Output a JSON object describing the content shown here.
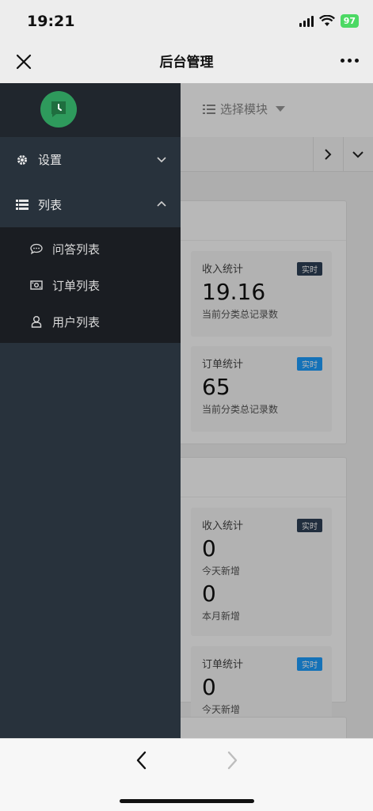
{
  "status": {
    "time": "19:21",
    "battery": "97"
  },
  "nav": {
    "title": "后台管理"
  },
  "topbar": {
    "module_select": "选择模块"
  },
  "panels": [
    {
      "cards": [
        {
          "label": "收入统计",
          "badge": "实时",
          "value": "19.16",
          "sub": "当前分类总记录数"
        },
        {
          "label": "订单统计",
          "badge": "实时",
          "value": "65",
          "sub": "当前分类总记录数"
        }
      ]
    },
    {
      "cards": [
        {
          "label": "收入统计",
          "badge": "实时",
          "value": "0",
          "sub": "今天新增",
          "value2": "0",
          "sub2": "本月新增"
        },
        {
          "label": "订单统计",
          "badge": "实时",
          "value": "0",
          "sub": "今天新增"
        }
      ]
    }
  ],
  "sidebar": {
    "menu": [
      {
        "label": "设置",
        "icon": "gear-icon"
      },
      {
        "label": "列表",
        "icon": "list-icon"
      }
    ],
    "submenu": [
      {
        "label": "问答列表",
        "icon": "chat-icon"
      },
      {
        "label": "订单列表",
        "icon": "money-icon"
      },
      {
        "label": "用户列表",
        "icon": "user-icon"
      }
    ]
  },
  "colors": {
    "badge_dark": "#2f4056",
    "badge_blue": "#1e9fff",
    "sidebar_bg": "#28323c",
    "avatar_green": "#2e9a5c"
  }
}
